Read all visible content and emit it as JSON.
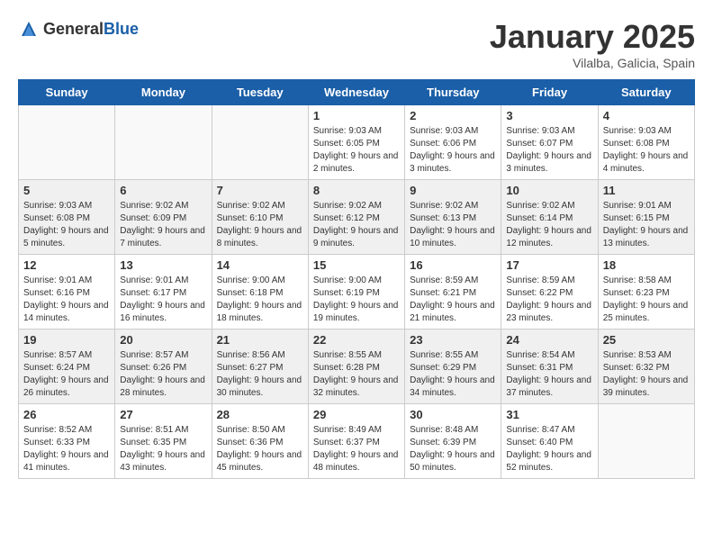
{
  "logo": {
    "general": "General",
    "blue": "Blue"
  },
  "title": {
    "month": "January 2025",
    "location": "Vilalba, Galicia, Spain"
  },
  "weekdays": [
    "Sunday",
    "Monday",
    "Tuesday",
    "Wednesday",
    "Thursday",
    "Friday",
    "Saturday"
  ],
  "weeks": [
    [
      {
        "day": "",
        "info": ""
      },
      {
        "day": "",
        "info": ""
      },
      {
        "day": "",
        "info": ""
      },
      {
        "day": "1",
        "info": "Sunrise: 9:03 AM\nSunset: 6:05 PM\nDaylight: 9 hours and 2 minutes."
      },
      {
        "day": "2",
        "info": "Sunrise: 9:03 AM\nSunset: 6:06 PM\nDaylight: 9 hours and 3 minutes."
      },
      {
        "day": "3",
        "info": "Sunrise: 9:03 AM\nSunset: 6:07 PM\nDaylight: 9 hours and 3 minutes."
      },
      {
        "day": "4",
        "info": "Sunrise: 9:03 AM\nSunset: 6:08 PM\nDaylight: 9 hours and 4 minutes."
      }
    ],
    [
      {
        "day": "5",
        "info": "Sunrise: 9:03 AM\nSunset: 6:08 PM\nDaylight: 9 hours and 5 minutes."
      },
      {
        "day": "6",
        "info": "Sunrise: 9:02 AM\nSunset: 6:09 PM\nDaylight: 9 hours and 7 minutes."
      },
      {
        "day": "7",
        "info": "Sunrise: 9:02 AM\nSunset: 6:10 PM\nDaylight: 9 hours and 8 minutes."
      },
      {
        "day": "8",
        "info": "Sunrise: 9:02 AM\nSunset: 6:12 PM\nDaylight: 9 hours and 9 minutes."
      },
      {
        "day": "9",
        "info": "Sunrise: 9:02 AM\nSunset: 6:13 PM\nDaylight: 9 hours and 10 minutes."
      },
      {
        "day": "10",
        "info": "Sunrise: 9:02 AM\nSunset: 6:14 PM\nDaylight: 9 hours and 12 minutes."
      },
      {
        "day": "11",
        "info": "Sunrise: 9:01 AM\nSunset: 6:15 PM\nDaylight: 9 hours and 13 minutes."
      }
    ],
    [
      {
        "day": "12",
        "info": "Sunrise: 9:01 AM\nSunset: 6:16 PM\nDaylight: 9 hours and 14 minutes."
      },
      {
        "day": "13",
        "info": "Sunrise: 9:01 AM\nSunset: 6:17 PM\nDaylight: 9 hours and 16 minutes."
      },
      {
        "day": "14",
        "info": "Sunrise: 9:00 AM\nSunset: 6:18 PM\nDaylight: 9 hours and 18 minutes."
      },
      {
        "day": "15",
        "info": "Sunrise: 9:00 AM\nSunset: 6:19 PM\nDaylight: 9 hours and 19 minutes."
      },
      {
        "day": "16",
        "info": "Sunrise: 8:59 AM\nSunset: 6:21 PM\nDaylight: 9 hours and 21 minutes."
      },
      {
        "day": "17",
        "info": "Sunrise: 8:59 AM\nSunset: 6:22 PM\nDaylight: 9 hours and 23 minutes."
      },
      {
        "day": "18",
        "info": "Sunrise: 8:58 AM\nSunset: 6:23 PM\nDaylight: 9 hours and 25 minutes."
      }
    ],
    [
      {
        "day": "19",
        "info": "Sunrise: 8:57 AM\nSunset: 6:24 PM\nDaylight: 9 hours and 26 minutes."
      },
      {
        "day": "20",
        "info": "Sunrise: 8:57 AM\nSunset: 6:26 PM\nDaylight: 9 hours and 28 minutes."
      },
      {
        "day": "21",
        "info": "Sunrise: 8:56 AM\nSunset: 6:27 PM\nDaylight: 9 hours and 30 minutes."
      },
      {
        "day": "22",
        "info": "Sunrise: 8:55 AM\nSunset: 6:28 PM\nDaylight: 9 hours and 32 minutes."
      },
      {
        "day": "23",
        "info": "Sunrise: 8:55 AM\nSunset: 6:29 PM\nDaylight: 9 hours and 34 minutes."
      },
      {
        "day": "24",
        "info": "Sunrise: 8:54 AM\nSunset: 6:31 PM\nDaylight: 9 hours and 37 minutes."
      },
      {
        "day": "25",
        "info": "Sunrise: 8:53 AM\nSunset: 6:32 PM\nDaylight: 9 hours and 39 minutes."
      }
    ],
    [
      {
        "day": "26",
        "info": "Sunrise: 8:52 AM\nSunset: 6:33 PM\nDaylight: 9 hours and 41 minutes."
      },
      {
        "day": "27",
        "info": "Sunrise: 8:51 AM\nSunset: 6:35 PM\nDaylight: 9 hours and 43 minutes."
      },
      {
        "day": "28",
        "info": "Sunrise: 8:50 AM\nSunset: 6:36 PM\nDaylight: 9 hours and 45 minutes."
      },
      {
        "day": "29",
        "info": "Sunrise: 8:49 AM\nSunset: 6:37 PM\nDaylight: 9 hours and 48 minutes."
      },
      {
        "day": "30",
        "info": "Sunrise: 8:48 AM\nSunset: 6:39 PM\nDaylight: 9 hours and 50 minutes."
      },
      {
        "day": "31",
        "info": "Sunrise: 8:47 AM\nSunset: 6:40 PM\nDaylight: 9 hours and 52 minutes."
      },
      {
        "day": "",
        "info": ""
      }
    ]
  ]
}
